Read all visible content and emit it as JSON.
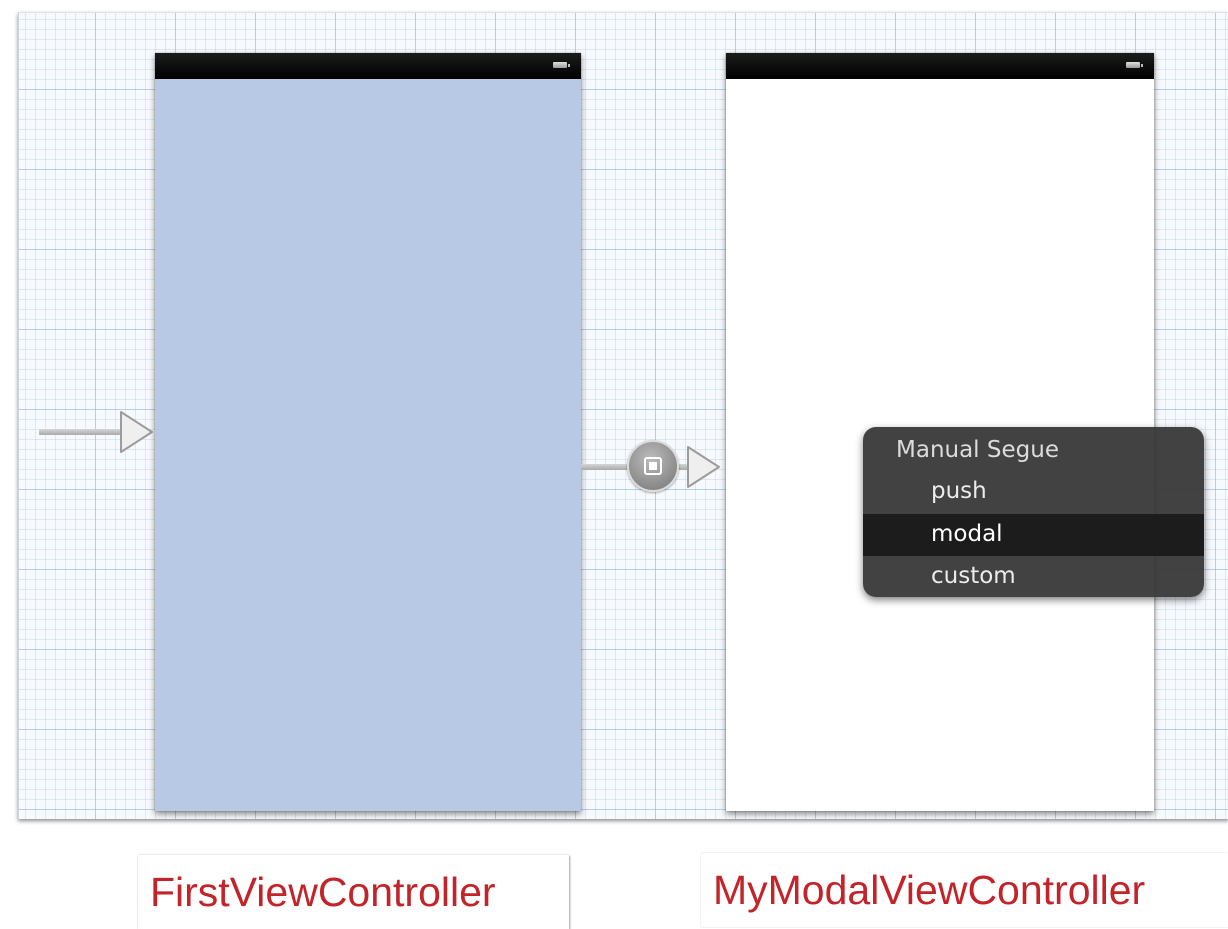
{
  "menu": {
    "header": "Manual Segue",
    "items": [
      {
        "label": "push",
        "selected": false
      },
      {
        "label": "modal",
        "selected": true
      },
      {
        "label": "custom",
        "selected": false
      }
    ]
  },
  "captions": {
    "first": "FirstViewController",
    "modal": "MyModalViewController"
  },
  "colors": {
    "first_scene_background": "#b8c9e6",
    "modal_scene_background": "#ffffff",
    "caption_text": "#c3242a",
    "status_bar": "#000000",
    "menu_background": "#343434",
    "menu_selected_row": "#1c1c1c"
  },
  "icons": {
    "status_bar": "battery-icon",
    "initial_connector": "arrow-right-icon",
    "segue": "segue-modal-icon"
  }
}
